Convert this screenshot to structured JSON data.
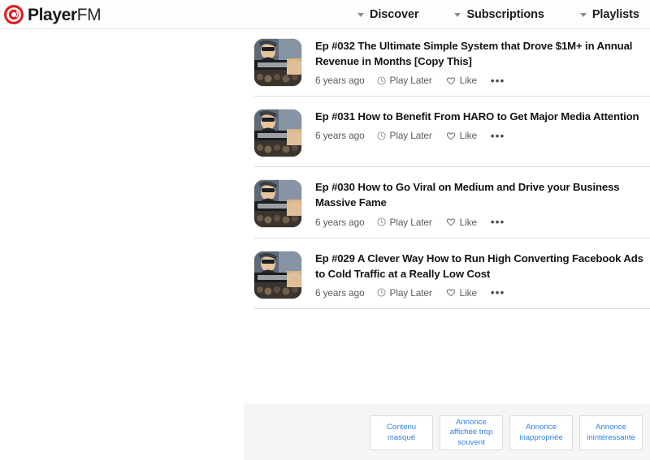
{
  "header": {
    "logo": {
      "icon": "player-fm-logo-icon",
      "name_bold": "Player",
      "name_light": "FM",
      "brand_color": "#e01f26"
    },
    "nav": [
      {
        "label": "Discover",
        "icon": "chevron-down-icon"
      },
      {
        "label": "Subscriptions",
        "icon": "chevron-down-icon"
      },
      {
        "label": "Playlists",
        "icon": "chevron-down-icon"
      }
    ]
  },
  "episode_list": {
    "actions": {
      "play_later_label": "Play Later",
      "play_later_icon": "clock-circle-icon",
      "like_label": "Like",
      "like_icon": "heart-outline-icon",
      "more_label": "•••",
      "more_icon": "ellipsis-icon"
    },
    "episodes": [
      {
        "title": "Ep #032 The Ultimate Simple System that Drove $1M+ in Annual Revenue in Months [Copy This]",
        "age": "6 years ago",
        "artwork": "podcast-cover-art"
      },
      {
        "title": "Ep #031 How to Benefit From HARO to Get Major Media Attention",
        "age": "6 years ago",
        "artwork": "podcast-cover-art"
      },
      {
        "title": "Ep #030 How to Go Viral on Medium and Drive your Business Massive Fame",
        "age": "6 years ago",
        "artwork": "podcast-cover-art"
      },
      {
        "title": "Ep #029 A Clever Way How to Run High Converting Facebook Ads to Cold Traffic at a Really Low Cost",
        "age": "6 years ago",
        "artwork": "podcast-cover-art"
      }
    ]
  },
  "ad_feedback": {
    "link_color": "#2a7fe8",
    "buttons": [
      {
        "label": "Contenu\nmasqué"
      },
      {
        "label": "Annonce\naffichée trop\nsouvent"
      },
      {
        "label": "Annonce\ninappropriée"
      },
      {
        "label": "Annonce\ninintéressante"
      }
    ]
  }
}
